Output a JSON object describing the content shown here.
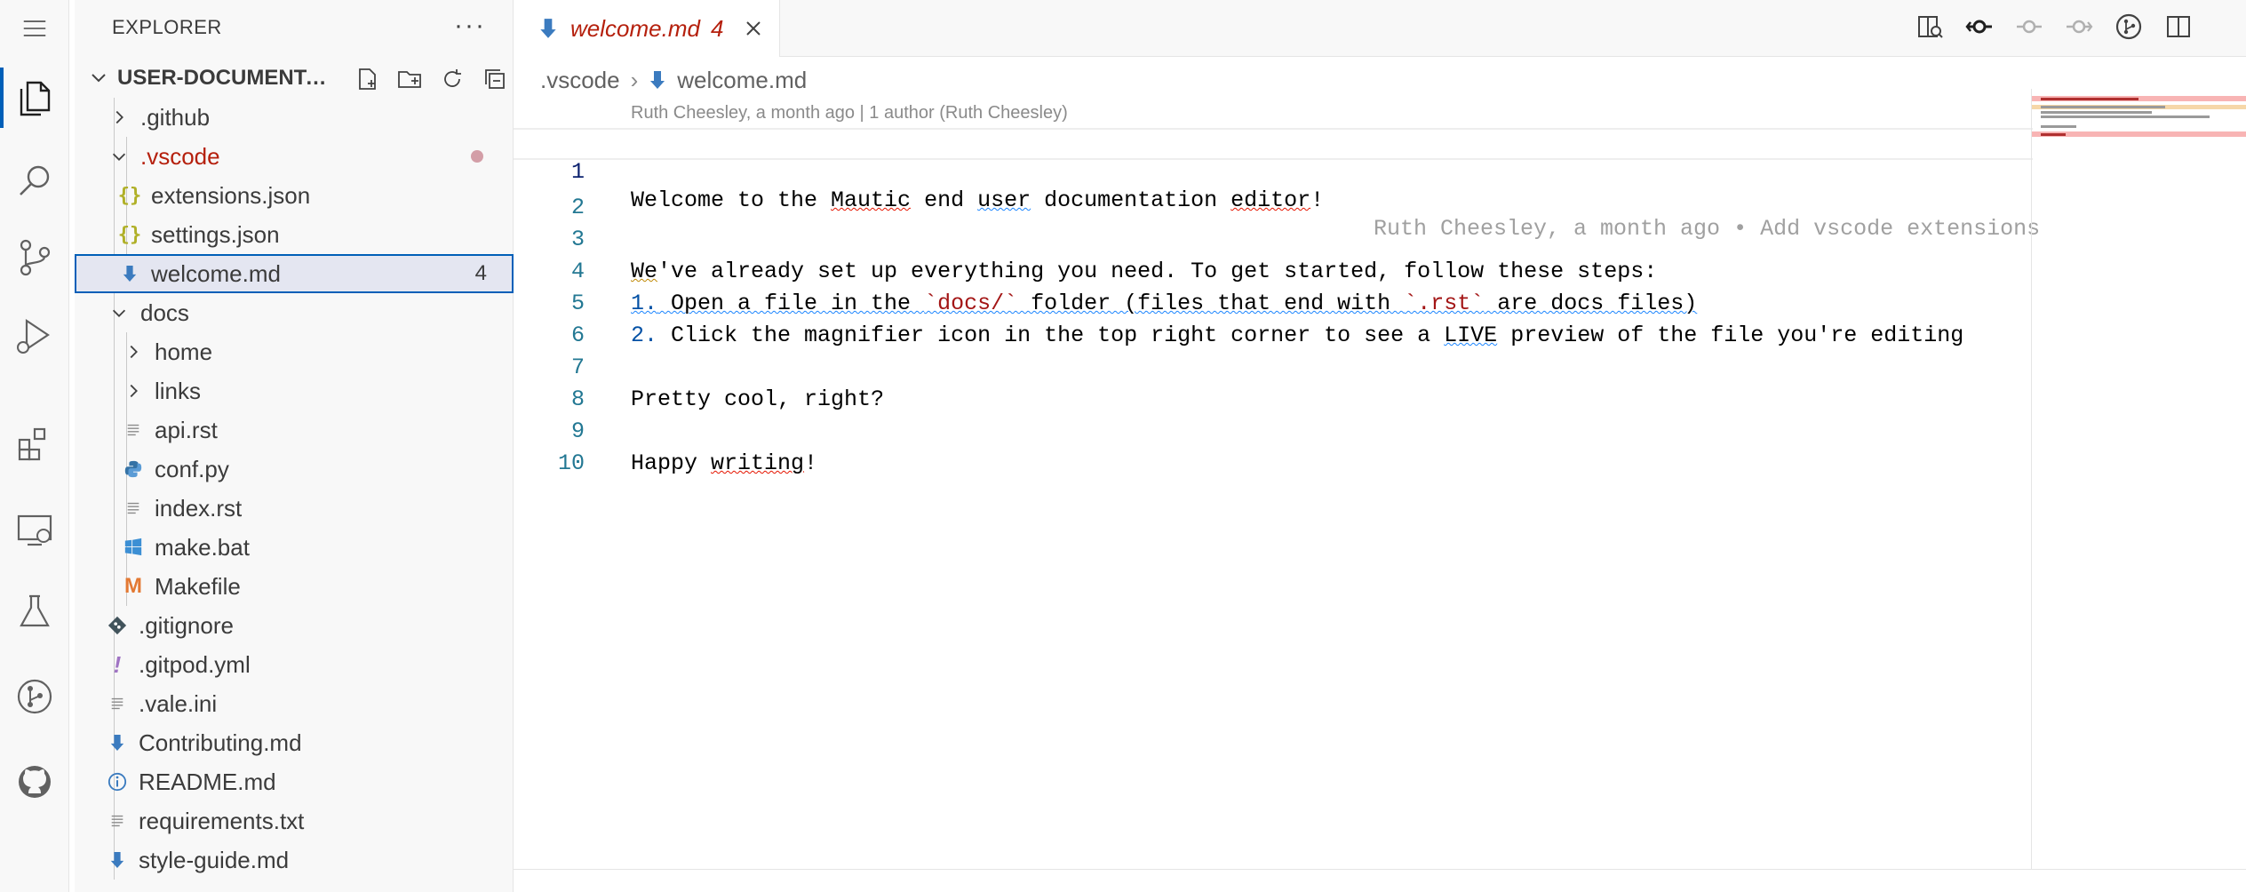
{
  "sidebar": {
    "title": "EXPLORER",
    "more": "···",
    "workspace": "USER-DOCUMENTATION",
    "items": [
      {
        "label": ".github",
        "type": "folder-closed"
      },
      {
        "label": ".vscode",
        "type": "folder-open",
        "status": "modified"
      },
      {
        "label": "extensions.json",
        "type": "json"
      },
      {
        "label": "settings.json",
        "type": "json"
      },
      {
        "label": "welcome.md",
        "type": "markdown",
        "badge": "4"
      },
      {
        "label": "docs",
        "type": "folder-open"
      },
      {
        "label": "home",
        "type": "folder-closed"
      },
      {
        "label": "links",
        "type": "folder-closed"
      },
      {
        "label": "api.rst",
        "type": "text"
      },
      {
        "label": "conf.py",
        "type": "python"
      },
      {
        "label": "index.rst",
        "type": "text"
      },
      {
        "label": "make.bat",
        "type": "windows"
      },
      {
        "label": "Makefile",
        "type": "makefile"
      },
      {
        "label": ".gitignore",
        "type": "git"
      },
      {
        "label": ".gitpod.yml",
        "type": "yaml"
      },
      {
        "label": ".vale.ini",
        "type": "text"
      },
      {
        "label": "Contributing.md",
        "type": "markdown"
      },
      {
        "label": "README.md",
        "type": "info"
      },
      {
        "label": "requirements.txt",
        "type": "text"
      },
      {
        "label": "style-guide.md",
        "type": "markdown"
      }
    ]
  },
  "tab": {
    "title": "welcome.md",
    "problems": "4"
  },
  "breadcrumb": {
    "folder": ".vscode",
    "file": "welcome.md"
  },
  "editor": {
    "blame_header": "Ruth Cheesley, a month ago | 1 author (Ruth Cheesley)",
    "inline_blame": "Ruth Cheesley, a month ago • Add vscode extensions",
    "line_numbers": [
      "1",
      "2",
      "3",
      "4",
      "5",
      "6",
      "7",
      "8",
      "9",
      "10"
    ],
    "lines": {
      "l1": {
        "a": "Welcome to the ",
        "b": "Mautic",
        "c": " end ",
        "d": "user",
        "e": " documentation ",
        "f": "editor",
        "g": "!"
      },
      "l3": {
        "a": "We",
        "b": "'ve already set up everything you need. To get started, follow these steps:"
      },
      "l4": {
        "num": "1.",
        "a": " Open a file in the ",
        "code1": "`docs/`",
        "b": " folder (files that end with ",
        "code2": "`.rst`",
        "c": " are docs files)"
      },
      "l5": {
        "num": "2.",
        "a": " Click the magnifier icon in the top right corner to see a ",
        "live": "LIVE",
        "b": " preview of the file you're editing"
      },
      "l7": "Pretty cool, right?",
      "l9": {
        "a": "Happy ",
        "b": "writing",
        "c": "!"
      }
    }
  },
  "colors": {
    "accent": "#005fb8",
    "error": "#e51400",
    "modified": "#b5200d"
  }
}
